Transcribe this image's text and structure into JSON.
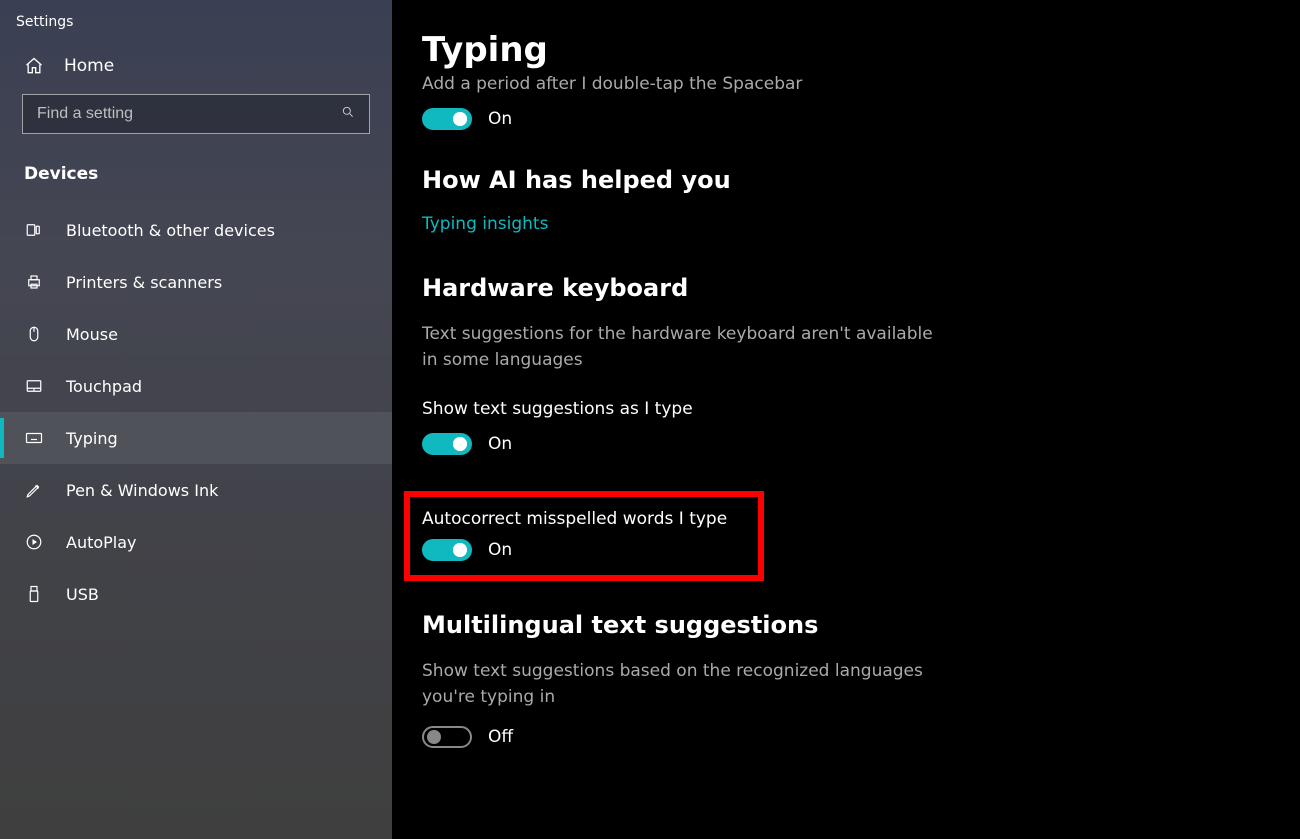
{
  "window": {
    "title": "Settings"
  },
  "sidebar": {
    "home": "Home",
    "search_placeholder": "Find a setting",
    "section": "Devices",
    "items": [
      {
        "icon": "bluetooth-icon",
        "label": "Bluetooth & other devices"
      },
      {
        "icon": "printer-icon",
        "label": "Printers & scanners"
      },
      {
        "icon": "mouse-icon",
        "label": "Mouse"
      },
      {
        "icon": "touchpad-icon",
        "label": "Touchpad"
      },
      {
        "icon": "keyboard-icon",
        "label": "Typing"
      },
      {
        "icon": "pen-icon",
        "label": "Pen & Windows Ink"
      },
      {
        "icon": "autoplay-icon",
        "label": "AutoPlay"
      },
      {
        "icon": "usb-icon",
        "label": "USB"
      }
    ],
    "active_index": 4
  },
  "main": {
    "title": "Typing",
    "spacebar_desc": "Add a period after I double-tap the Spacebar",
    "spacebar_toggle": {
      "state": "On"
    },
    "ai_heading": "How AI has helped you",
    "ai_link": "Typing insights",
    "hw_heading": "Hardware keyboard",
    "hw_desc": "Text suggestions for the hardware keyboard aren't available in some languages",
    "hw_suggest_label": "Show text suggestions as I type",
    "hw_suggest_toggle": {
      "state": "On"
    },
    "autocorrect_label": "Autocorrect misspelled words I type",
    "autocorrect_toggle": {
      "state": "On"
    },
    "ml_heading": "Multilingual text suggestions",
    "ml_desc": "Show text suggestions based on the recognized languages you're typing in",
    "ml_toggle": {
      "state": "Off"
    }
  }
}
